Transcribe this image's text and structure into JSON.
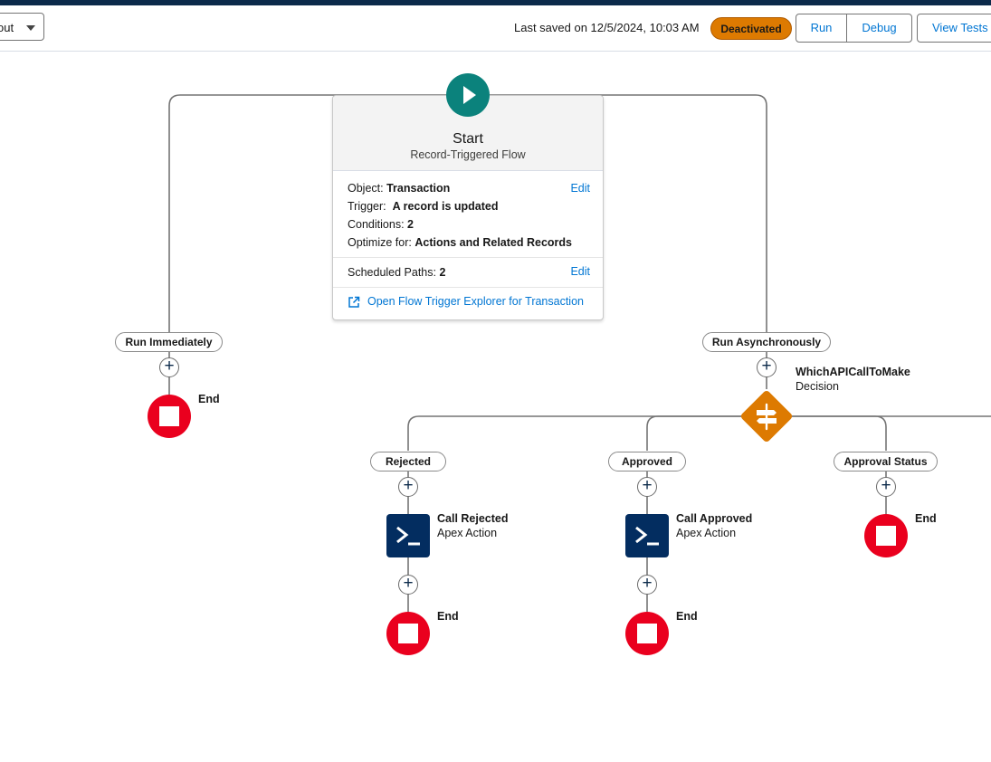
{
  "header": {
    "layout_select_value": "out",
    "saved_text": "Last saved on 12/5/2024, 10:03 AM",
    "status_badge": "Deactivated",
    "run_label": "Run",
    "debug_label": "Debug",
    "view_tests_label": "View Tests"
  },
  "start": {
    "title": "Start",
    "subtitle": "Record-Triggered Flow",
    "object_label": "Object:",
    "object_value": "Transaction",
    "trigger_label": "Trigger:",
    "trigger_value": "A record is updated",
    "conditions_label": "Conditions:",
    "conditions_value": "2",
    "optimize_label": "Optimize for:",
    "optimize_value": "Actions and Related Records",
    "edit_label": "Edit",
    "scheduled_label": "Scheduled Paths:",
    "scheduled_value": "2",
    "explorer_link": "Open Flow Trigger Explorer for Transaction"
  },
  "paths": {
    "immediate": "Run Immediately",
    "async": "Run Asynchronously"
  },
  "decision": {
    "name": "WhichAPICallToMake",
    "type": "Decision",
    "outcomes": [
      "Rejected",
      "Approved",
      "Approval Status"
    ]
  },
  "actions": {
    "rejected_name": "Call Rejected",
    "approved_name": "Call Approved",
    "type": "Apex Action"
  },
  "end_label": "End",
  "colors": {
    "start_node": "#0b827c",
    "end_node": "#ea001e",
    "decision_node": "#dd7a01",
    "apex_node": "#032d60",
    "link": "#0176d3",
    "badge": "#dd7a01"
  }
}
